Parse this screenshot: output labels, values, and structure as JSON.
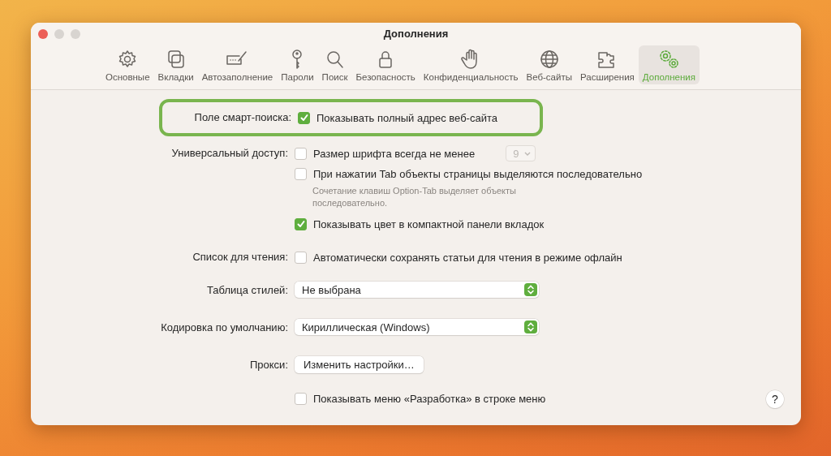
{
  "window": {
    "title": "Дополнения"
  },
  "tabs": [
    {
      "label": "Основные",
      "selected": false
    },
    {
      "label": "Вкладки",
      "selected": false
    },
    {
      "label": "Автозаполнение",
      "selected": false
    },
    {
      "label": "Пароли",
      "selected": false
    },
    {
      "label": "Поиск",
      "selected": false
    },
    {
      "label": "Безопасность",
      "selected": false
    },
    {
      "label": "Конфиденциальность",
      "selected": false
    },
    {
      "label": "Веб-сайты",
      "selected": false
    },
    {
      "label": "Расширения",
      "selected": false
    },
    {
      "label": "Дополнения",
      "selected": true
    }
  ],
  "sections": [
    {
      "label": "Поле смарт-поиска:",
      "highlighted": true,
      "items": [
        {
          "kind": "checkbox",
          "label": "Показывать полный адрес веб-сайта",
          "checked": true
        }
      ]
    },
    {
      "label": "Универсальный доступ:",
      "items": [
        {
          "kind": "checkbox",
          "label": "Размер шрифта всегда не менее",
          "checked": false,
          "stepper": {
            "value": "9",
            "disabled": true
          }
        },
        {
          "kind": "checkbox",
          "label": "При нажатии Tab объекты страницы выделяются последовательно",
          "checked": false
        },
        {
          "kind": "note",
          "label": "Сочетание клавиш Option-Tab выделяет объекты последовательно."
        },
        {
          "kind": "checkbox",
          "label": "Показывать цвет в компактной панели вкладок",
          "checked": true
        }
      ]
    },
    {
      "label": "Список для чтения:",
      "items": [
        {
          "kind": "checkbox",
          "label": "Автоматически сохранять статьи для чтения в режиме офлайн",
          "checked": false
        }
      ]
    },
    {
      "label": "Таблица стилей:",
      "items": [
        {
          "kind": "select",
          "value": "Не выбрана"
        }
      ]
    },
    {
      "label": "Кодировка по умолчанию:",
      "items": [
        {
          "kind": "select",
          "value": "Кириллическая (Windows)"
        }
      ]
    },
    {
      "label": "Прокси:",
      "items": [
        {
          "kind": "button",
          "label": "Изменить настройки…"
        }
      ]
    },
    {
      "items": [
        {
          "kind": "checkbox",
          "label": "Показывать меню «Разработка» в строке меню",
          "checked": false
        }
      ]
    }
  ],
  "help": "?"
}
